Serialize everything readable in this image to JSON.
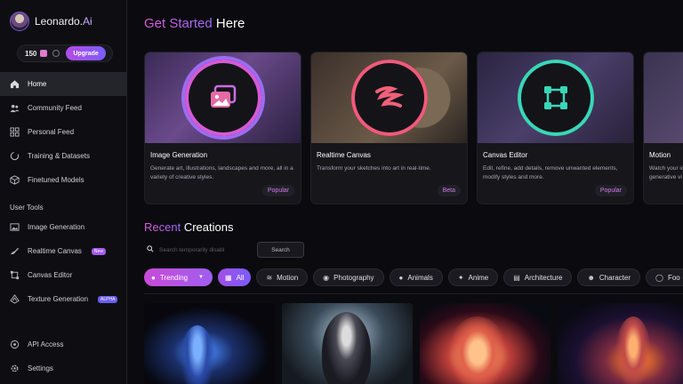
{
  "brand": {
    "name": "Leonardo.",
    "suffix": "Ai"
  },
  "credits": {
    "count": "150",
    "upgrade_label": "Upgrade"
  },
  "nav": {
    "main": [
      {
        "label": "Home",
        "icon": "home-icon"
      },
      {
        "label": "Community Feed",
        "icon": "users-icon"
      },
      {
        "label": "Personal Feed",
        "icon": "grid-icon"
      },
      {
        "label": "Training & Datasets",
        "icon": "refresh-icon"
      },
      {
        "label": "Finetuned Models",
        "icon": "cube-icon"
      }
    ],
    "tools_label": "User Tools",
    "tools": [
      {
        "label": "Image Generation",
        "icon": "image-icon"
      },
      {
        "label": "Realtime Canvas",
        "icon": "brush-icon",
        "badge": "New"
      },
      {
        "label": "Canvas Editor",
        "icon": "crop-icon"
      },
      {
        "label": "Texture Generation",
        "icon": "texture-icon",
        "badge": "ALPHA"
      }
    ],
    "bottom": [
      {
        "label": "API Access",
        "icon": "api-icon"
      },
      {
        "label": "Settings",
        "icon": "gear-icon"
      }
    ]
  },
  "header": {
    "title_accent": "Get Started",
    "title_rest": " Here"
  },
  "cards": [
    {
      "title": "Image Generation",
      "desc": "Generate art, illustrations, landscapes and more, all in a variety of creative styles.",
      "tag": "Popular"
    },
    {
      "title": "Realtime Canvas",
      "desc": "Transform your sketches into art in real-time.",
      "tag": "Beta"
    },
    {
      "title": "Canvas Editor",
      "desc": "Edit, refine, add details, remove unwanted elements, modify styles and more.",
      "tag": "Popular"
    },
    {
      "title": "Motion",
      "desc": "Watch your ic generative vi",
      "tag": ""
    }
  ],
  "recent": {
    "title_accent": "Recent",
    "title_rest": " Creations",
    "search_placeholder": "Search temporarily disabl",
    "search_button": "Search"
  },
  "filters": {
    "trending": "Trending",
    "chips": [
      {
        "label": "All",
        "icon": "grid-icon"
      },
      {
        "label": "Motion",
        "icon": "motion-icon"
      },
      {
        "label": "Photography",
        "icon": "camera-icon"
      },
      {
        "label": "Animals",
        "icon": "paw-icon"
      },
      {
        "label": "Anime",
        "icon": "sparkle-icon"
      },
      {
        "label": "Architecture",
        "icon": "building-icon"
      },
      {
        "label": "Character",
        "icon": "person-icon"
      },
      {
        "label": "Foo",
        "icon": "food-icon"
      }
    ]
  },
  "colors": {
    "accent": "#a24ee6",
    "accent2": "#7b5cff",
    "bg": "#0b0b0f"
  }
}
